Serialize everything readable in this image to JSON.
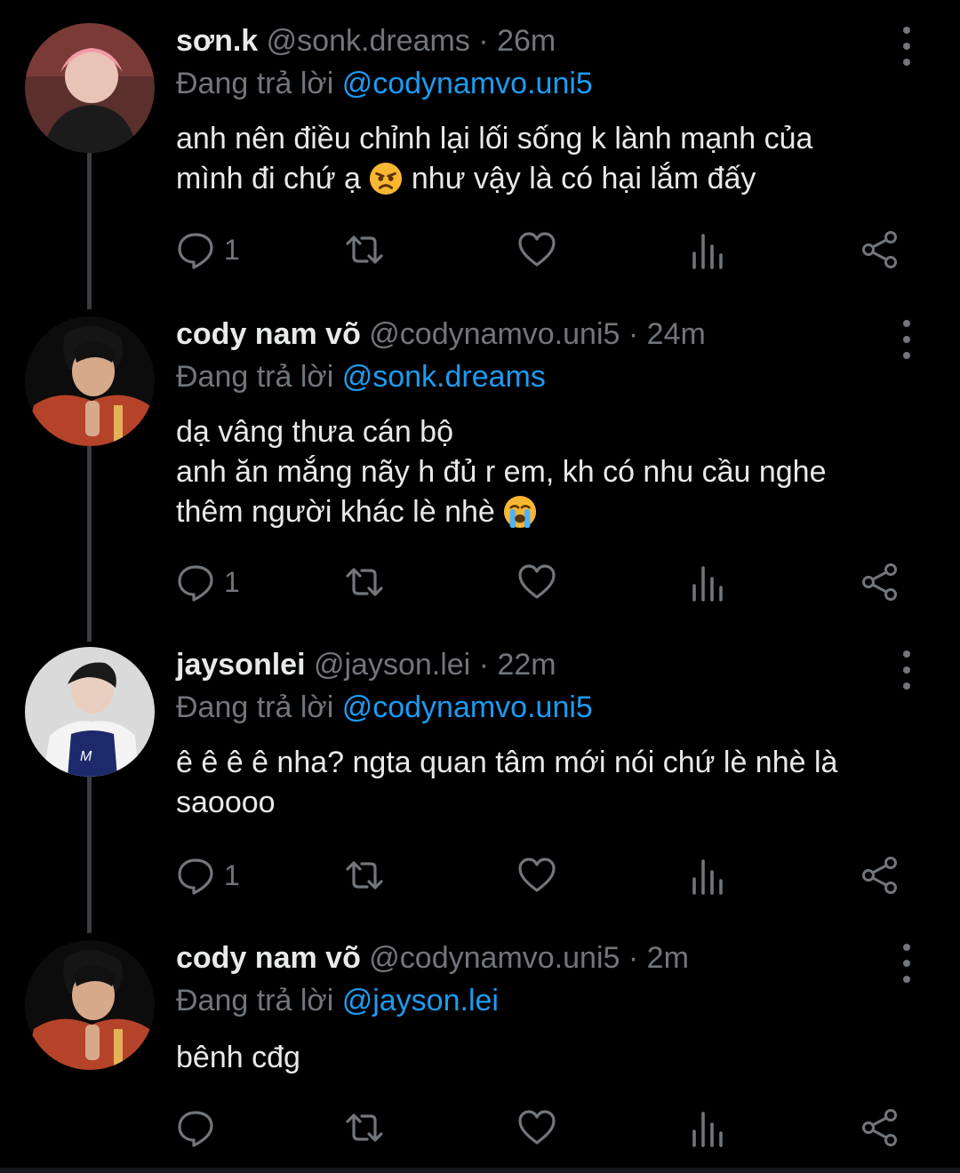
{
  "tweets": [
    {
      "name": "sơn.k",
      "handle": "@sonk.dreams",
      "sep": "·",
      "time": "26m",
      "replying_prefix": "Đang trả lời ",
      "replying_to": "@codynamvo.uni5",
      "body_lines": [
        "anh nên điều chỉnh lại lối sống k lành mạnh của",
        "mình đi chứ ạ",
        "như vậy là có hại lắm đấy"
      ],
      "reply_count": "1"
    },
    {
      "name": "cody nam võ",
      "handle": "@codynamvo.uni5",
      "sep": "·",
      "time": "24m",
      "replying_prefix": "Đang trả lời ",
      "replying_to": "@sonk.dreams",
      "body_lines": [
        "dạ vâng thưa cán bộ",
        "anh ăn mắng nãy h đủ r em, kh có nhu cầu nghe",
        "thêm người khác lè nhè"
      ],
      "reply_count": "1"
    },
    {
      "name": "jaysonlei",
      "handle": "@jayson.lei",
      "sep": "·",
      "time": "22m",
      "replying_prefix": "Đang trả lời ",
      "replying_to": "@codynamvo.uni5",
      "body_lines": [
        "ê ê ê ê nha? ngta quan tâm mới nói chứ lè nhè là",
        "saoooo"
      ],
      "reply_count": "1"
    },
    {
      "name": "cody nam võ",
      "handle": "@codynamvo.uni5",
      "sep": "·",
      "time": "2m",
      "replying_prefix": "Đang trả lời ",
      "replying_to": "@jayson.lei",
      "body_lines": [
        "bênh cđg"
      ],
      "reply_count": ""
    }
  ],
  "icons": {
    "reply": "reply-icon",
    "repost": "repost-icon",
    "like": "heart-icon",
    "views": "views-icon",
    "share": "share-icon",
    "more": "more-icon"
  },
  "colors": {
    "background": "#000000",
    "text": "#e7e9ea",
    "muted": "#71767b",
    "link": "#1d9bf0"
  }
}
